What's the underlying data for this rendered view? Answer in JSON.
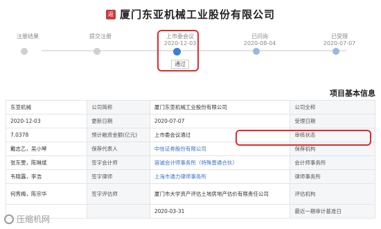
{
  "title": {
    "icon_text": "返",
    "text": "厦门东亚机械工业股份有限公司"
  },
  "timeline": {
    "steps": [
      {
        "label": "已受理",
        "date": "2020-07-07",
        "state": "done"
      },
      {
        "label": "已问询",
        "date": "2020-08-04",
        "state": "done"
      },
      {
        "label": "上市委会议",
        "date": "2020-12-03",
        "state": "active",
        "status": "通过"
      },
      {
        "label": "提交注册",
        "date": "",
        "state": "pending"
      },
      {
        "label": "注册结果",
        "date": "",
        "state": "pending"
      }
    ]
  },
  "section": {
    "title": "项目基本信息"
  },
  "table": {
    "rows": [
      {
        "cells": [
          {
            "text": "东亚机械",
            "type": "val"
          },
          {
            "text": "公司简称",
            "type": "lbl"
          },
          {
            "text": "厦门东亚机械工业股份有限公司",
            "type": "val"
          },
          {
            "text": "公司全称",
            "type": "lbl"
          }
        ]
      },
      {
        "cells": [
          {
            "text": "2020-12-03",
            "type": "val"
          },
          {
            "text": "更新日期",
            "type": "lbl"
          },
          {
            "text": "2020-07-07",
            "type": "val"
          },
          {
            "text": "受理日期",
            "type": "lbl"
          }
        ]
      },
      {
        "cells": [
          {
            "text": "7.0378",
            "type": "val"
          },
          {
            "text": "预计融资金额(亿元)",
            "type": "lbl"
          },
          {
            "text": "上市委会议通过",
            "type": "val"
          },
          {
            "text": "审核状态",
            "type": "lbl"
          }
        ]
      },
      {
        "cells": [
          {
            "text": "戴志乙，吴小琴",
            "type": "val"
          },
          {
            "text": "保荐代表人",
            "type": "lbl"
          },
          {
            "text": "中信证券股份有限公司",
            "type": "link"
          },
          {
            "text": "保荐机构",
            "type": "lbl"
          }
        ]
      },
      {
        "cells": [
          {
            "text": "张东雯，陈琳斌",
            "type": "val"
          },
          {
            "text": "签字会计师",
            "type": "lbl"
          },
          {
            "text": "容诚会计师事务所（特殊普通合伙）",
            "type": "link"
          },
          {
            "text": "会计师事务所",
            "type": "lbl"
          }
        ]
      },
      {
        "cells": [
          {
            "text": "韦晓露，李浩",
            "type": "val"
          },
          {
            "text": "签字律师",
            "type": "lbl"
          },
          {
            "text": "上海市通力律师事务所",
            "type": "link"
          },
          {
            "text": "律师事务所",
            "type": "lbl"
          }
        ]
      },
      {
        "tall": true,
        "cells": [
          {
            "text": "何秀梅，陈宗华",
            "type": "val"
          },
          {
            "text": "签字评估师",
            "type": "lbl"
          },
          {
            "text": "厦门市大学资产评估土地房地产估价有限责任公司",
            "type": "val"
          },
          {
            "text": "评估机构",
            "type": "lbl"
          }
        ]
      },
      {
        "cells": [
          {
            "text": "",
            "type": "val"
          },
          {
            "text": "",
            "type": "lbl"
          },
          {
            "text": "2020-03-31",
            "type": "val"
          },
          {
            "text": "最近一期审计基准日",
            "type": "lbl"
          }
        ]
      }
    ]
  },
  "watermark": {
    "text": "压缩机网"
  }
}
